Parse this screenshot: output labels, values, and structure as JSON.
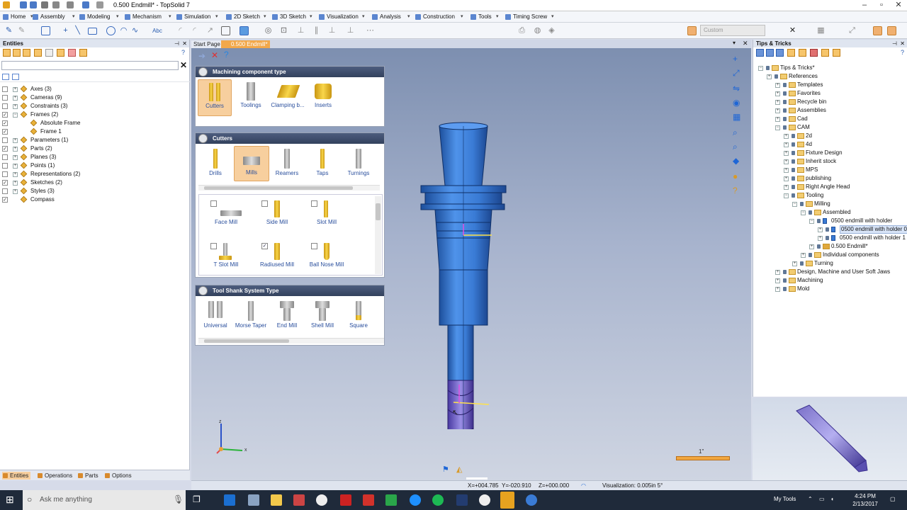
{
  "window": {
    "title": "0.500 Endmill* - TopSolid 7"
  },
  "menu": [
    "Home",
    "Assembly",
    "Modeling",
    "Mechanism",
    "Simulation",
    "2D Sketch",
    "3D Sketch",
    "Visualization",
    "Analysis",
    "Construction",
    "Tools",
    "Timing Screw"
  ],
  "toolbar": {
    "style_select": "Custom"
  },
  "entities": {
    "title": "Entities",
    "tree": [
      {
        "label": "Axes (3)",
        "checked": false
      },
      {
        "label": "Cameras (9)",
        "checked": false
      },
      {
        "label": "Constraints (3)",
        "checked": false
      },
      {
        "label": "Frames (2)",
        "checked": true
      },
      {
        "label": "Absolute Frame",
        "checked": true
      },
      {
        "label": "Frame 1",
        "checked": true
      },
      {
        "label": "Parameters (1)",
        "checked": false
      },
      {
        "label": "Parts (2)",
        "checked": true
      },
      {
        "label": "Planes (3)",
        "checked": false
      },
      {
        "label": "Points (1)",
        "checked": false
      },
      {
        "label": "Representations (2)",
        "checked": false
      },
      {
        "label": "Sketches (2)",
        "checked": true
      },
      {
        "label": "Styles (3)",
        "checked": false
      },
      {
        "label": "Compass",
        "checked": true
      }
    ],
    "bottom_tabs": [
      "Entities",
      "Operations",
      "Parts",
      "Options"
    ]
  },
  "doc_tabs": [
    "Start Page",
    "0.500 Endmill*"
  ],
  "machining": {
    "component_type": {
      "title": "Machining component type",
      "items": [
        "Cutters",
        "Toolings",
        "Clamping b...",
        "Inserts"
      ],
      "selected": "Cutters"
    },
    "cutters": {
      "title": "Cutters",
      "items": [
        "Drills",
        "Mills",
        "Reamers",
        "Taps",
        "Turnings"
      ],
      "selected": "Mills"
    },
    "mills": [
      {
        "label": "Face Mill",
        "checked": false
      },
      {
        "label": "Side Mill",
        "checked": false
      },
      {
        "label": "Slot Mill",
        "checked": false
      },
      {
        "label": "T Slot Mill",
        "checked": false
      },
      {
        "label": "Radiused Mill",
        "checked": true
      },
      {
        "label": "Ball Nose Mill",
        "checked": false
      }
    ],
    "shank": {
      "title": "Tool Shank System Type",
      "items": [
        "Universal",
        "Morse Taper",
        "End Mill",
        "Shell Mill",
        "Square"
      ]
    }
  },
  "viewport": {
    "scale_label": "1\"",
    "axis_z": "z",
    "axis_x": "x",
    "axis_y": "y"
  },
  "status": {
    "x": "X=+004.785",
    "y": "Y=-020.910",
    "z": "Z=+000.000",
    "visualization": "Visualization: 0.005in 5°"
  },
  "tips": {
    "title": "Tips & Tricks",
    "tree": [
      "Tips & Tricks*",
      "References",
      "Templates",
      "Favorites",
      "Recycle bin",
      "Assemblies",
      "Cad",
      "CAM",
      "2d",
      "4d",
      "Fixture Design",
      "Inherit stock",
      "MPS",
      "publishing",
      "Right Angle Head",
      "Tooling",
      "Milling",
      "Assembled",
      "0500 endmill with holder",
      "0500 endmill with holder 0",
      "0500 endmill with holder 1",
      "0.500 Endmill*",
      "Individual components",
      "Turning",
      "Design, Machine and User Soft Jaws",
      "Machining",
      "Mold"
    ]
  },
  "taskbar": {
    "search": "Ask me anything",
    "my_tools": "My Tools",
    "time": "4:24 PM",
    "date": "2/13/2017"
  },
  "colors": {
    "accent": "#f7cf9e",
    "tool_blue": "#3a7bd5",
    "panel_header": "#3c4a66"
  }
}
